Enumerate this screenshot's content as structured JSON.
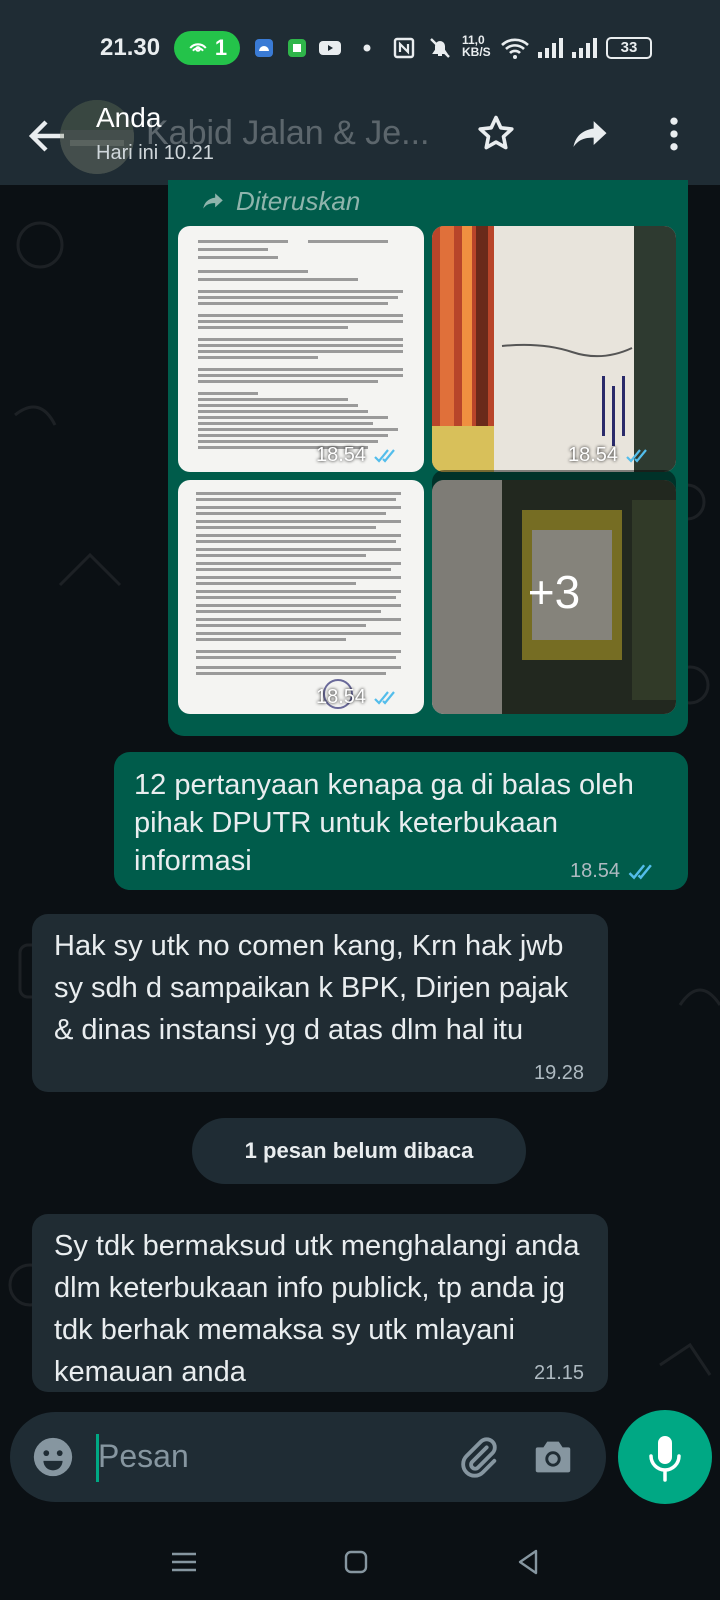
{
  "status_bar": {
    "time": "21.30",
    "hotspot_count": "1",
    "net_speed_top": "11,0",
    "net_speed_bottom": "KB/S",
    "battery": "33",
    "icons": [
      "hotspot-icon",
      "android-icon",
      "app-icon",
      "youtube-icon",
      "dot-icon",
      "nfc-icon",
      "mute-icon",
      "wifi-icon",
      "signal-icon",
      "signal-icon",
      "battery-icon"
    ]
  },
  "header": {
    "sender": "Anda",
    "datetime": "Hari ini 10.21",
    "chat_name": "Kabid Jalan & Je...",
    "actions": [
      "back-arrow-icon",
      "star-icon",
      "forward-icon",
      "more-vert-icon"
    ]
  },
  "messages": {
    "forwarded_label": "Diteruskan",
    "album_times": [
      "18.54",
      "18.54",
      "18.54"
    ],
    "more_count": "+3",
    "out_text": "12 pertanyaan kenapa ga di balas oleh pihak DPUTR untuk keterbukaan informasi",
    "out_time": "18.54",
    "in1_text": "Hak sy utk no comen kang, Krn hak jwb sy sdh d sampaikan k BPK, Dirjen pajak & dinas instansi yg d atas dlm hal itu",
    "in1_time": "19.28",
    "unread_label": "1 pesan belum dibaca",
    "in2_text": "Sy tdk bermaksud utk menghalangi anda dlm  keterbukaan info publick, tp anda jg tdk berhak memaksa sy utk mlayani kemauan anda",
    "in2_time": "21.15"
  },
  "input": {
    "placeholder": "Pesan"
  },
  "colors": {
    "outgoing_bubble": "#005c4b",
    "incoming_bubble": "#202c33",
    "accent": "#00a884",
    "read_ticks": "#53bdeb"
  }
}
